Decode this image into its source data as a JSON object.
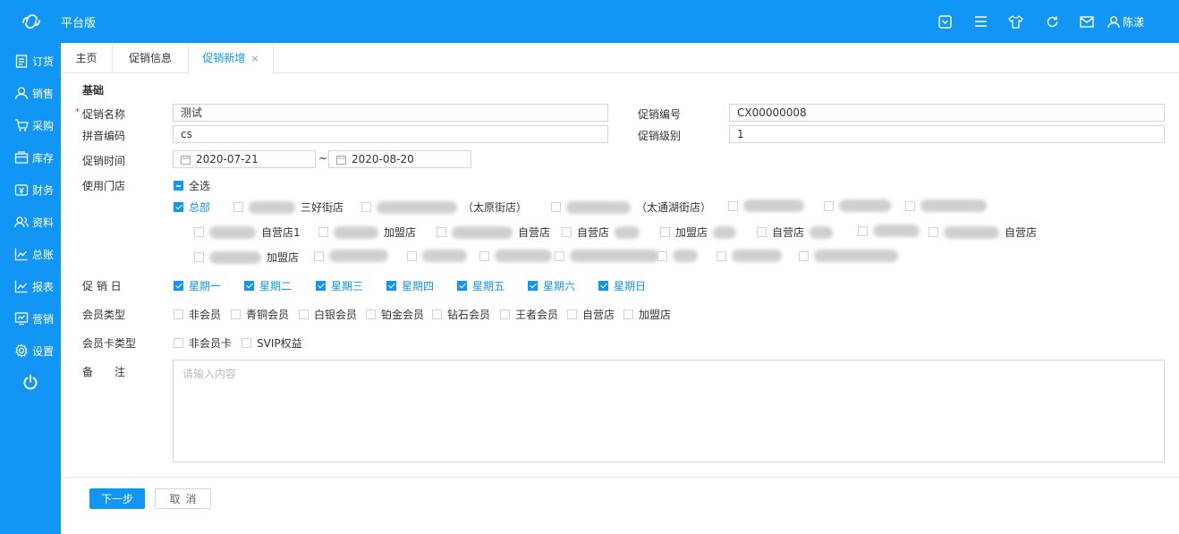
{
  "app": {
    "brand": "平台版",
    "user": "陈漾"
  },
  "sidebar": [
    {
      "label": "订货",
      "icon": "clipboard-icon"
    },
    {
      "label": "销售",
      "icon": "user-icon"
    },
    {
      "label": "采购",
      "icon": "cart-icon"
    },
    {
      "label": "库存",
      "icon": "box-icon"
    },
    {
      "label": "财务",
      "icon": "money-icon"
    },
    {
      "label": "资料",
      "icon": "users-icon"
    },
    {
      "label": "总账",
      "icon": "chart-icon"
    },
    {
      "label": "报表",
      "icon": "chart-icon"
    },
    {
      "label": "营销",
      "icon": "monitor-icon"
    },
    {
      "label": "设置",
      "icon": "gear-icon"
    }
  ],
  "tabs": [
    {
      "label": "主页"
    },
    {
      "label": "促销信息"
    },
    {
      "label": "促销新增",
      "close": "×"
    }
  ],
  "form": {
    "section": "基础",
    "name_label": "促销名称",
    "name_value": "测试",
    "code_label": "促销编号",
    "code_value": "CX00000008",
    "pinyin_label": "拼音编码",
    "pinyin_value": "cs",
    "level_label": "促销级别",
    "level_value": "1",
    "time_label": "促销时间",
    "start_date": "2020-07-21",
    "tilde": "~",
    "end_date": "2020-08-20",
    "stores_label": "使用门店",
    "select_all": "全选",
    "stores_row1": [
      "总部",
      "三好街店",
      "（太原街店）",
      "（太通湖街店）"
    ],
    "stores_row2": [
      "自营店1",
      "加盟店",
      "自营店",
      "自营店",
      "加盟店",
      "自营店",
      "自营店"
    ],
    "stores_row3": [
      "加盟店"
    ],
    "days_label": "促 销 日",
    "days": [
      "星期一",
      "星期二",
      "星期三",
      "星期四",
      "星期五",
      "星期六",
      "星期日"
    ],
    "member_label": "会员类型",
    "member_types": [
      "非会员",
      "青铜会员",
      "白银会员",
      "铂金会员",
      "钻石会员",
      "王者会员",
      "自营店",
      "加盟店"
    ],
    "card_label": "会员卡类型",
    "card_types": [
      "非会员卡",
      "SVIP权益"
    ],
    "remark_label": "备　　注",
    "remark_placeholder": "请输入内容"
  },
  "buttons": {
    "next": "下一步",
    "cancel": "取消"
  }
}
